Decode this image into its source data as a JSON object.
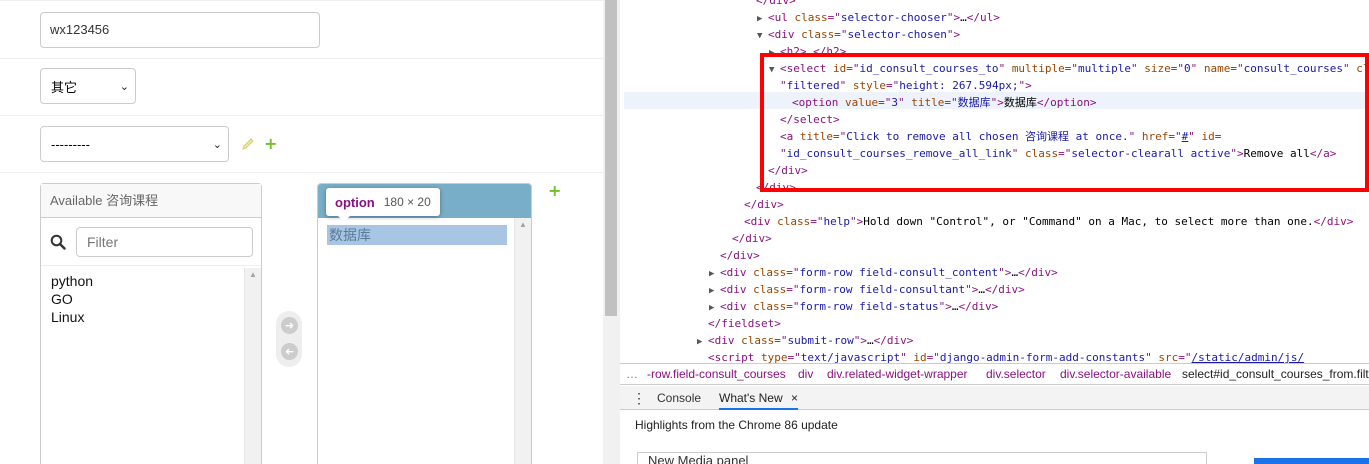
{
  "form": {
    "wechat_value": "wx123456",
    "source_select": "其它",
    "related_select": "---------",
    "available": {
      "title": "Available 咨询课程",
      "filter_placeholder": "Filter",
      "items": [
        "python",
        "GO",
        "Linux"
      ]
    },
    "chosen": {
      "items": [
        "数据库"
      ]
    },
    "colors": {
      "chosen_header": "#79aec8",
      "add_green": "#70bf2b"
    }
  },
  "inspect_tooltip": {
    "tag": "option",
    "dimensions": "180 × 20"
  },
  "devtools": {
    "lines": [
      {
        "indent": 0,
        "tri": "",
        "parts": [
          [
            "tg",
            "</div>"
          ]
        ]
      },
      {
        "indent": 1,
        "tri": "▶",
        "parts": [
          [
            "tg",
            "<ul "
          ],
          [
            "at",
            "class"
          ],
          [
            "tg",
            "=\""
          ],
          [
            "av",
            "selector-chooser"
          ],
          [
            "tg",
            "\">"
          ],
          [
            "tx",
            "…"
          ],
          [
            "tg",
            "</ul>"
          ]
        ]
      },
      {
        "indent": 1,
        "tri": "▼",
        "parts": [
          [
            "tg",
            "<div "
          ],
          [
            "at",
            "class"
          ],
          [
            "tg",
            "=\""
          ],
          [
            "av",
            "selector-chosen"
          ],
          [
            "tg",
            "\">"
          ]
        ]
      },
      {
        "indent": 2,
        "tri": "▶",
        "parts": [
          [
            "tg",
            "<h2>"
          ],
          [
            "tx",
            "…"
          ],
          [
            "tg",
            "</h2>"
          ]
        ]
      },
      {
        "indent": 2,
        "tri": "▼",
        "parts": [
          [
            "tg",
            "<select "
          ],
          [
            "at",
            "id"
          ],
          [
            "tg",
            "=\""
          ],
          [
            "av",
            "id_consult_courses_to"
          ],
          [
            "tg",
            "\" "
          ],
          [
            "at",
            "multiple"
          ],
          [
            "tg",
            "=\""
          ],
          [
            "av",
            "multiple"
          ],
          [
            "tg",
            "\" "
          ],
          [
            "at",
            "size"
          ],
          [
            "tg",
            "=\""
          ],
          [
            "av",
            "0"
          ],
          [
            "tg",
            "\" "
          ],
          [
            "at",
            "name"
          ],
          [
            "tg",
            "=\""
          ],
          [
            "av",
            "consult_courses"
          ],
          [
            "tg",
            "\" "
          ],
          [
            "at",
            "class"
          ],
          [
            "tg",
            "="
          ]
        ]
      },
      {
        "indent": 2,
        "tri": "",
        "parts": [
          [
            "tg",
            "\""
          ],
          [
            "av",
            "filtered"
          ],
          [
            "tg",
            "\" "
          ],
          [
            "at",
            "style"
          ],
          [
            "tg",
            "=\""
          ],
          [
            "av",
            "height: 267.594px;"
          ],
          [
            "tg",
            "\">"
          ]
        ]
      },
      {
        "indent": 3,
        "tri": "",
        "parts": [
          [
            "tg",
            "<option "
          ],
          [
            "at",
            "value"
          ],
          [
            "tg",
            "=\""
          ],
          [
            "av",
            "3"
          ],
          [
            "tg",
            "\" "
          ],
          [
            "at",
            "title"
          ],
          [
            "tg",
            "=\""
          ],
          [
            "av",
            "数据库"
          ],
          [
            "tg",
            "\">"
          ],
          [
            "tx",
            "数据库"
          ],
          [
            "tg",
            "</option>"
          ]
        ]
      },
      {
        "indent": 2,
        "tri": "",
        "parts": [
          [
            "tg",
            "</select>"
          ]
        ]
      },
      {
        "indent": 2,
        "tri": "",
        "parts": [
          [
            "tg",
            "<a "
          ],
          [
            "at",
            "title"
          ],
          [
            "tg",
            "=\""
          ],
          [
            "av",
            "Click to remove all chosen 咨询课程 at once."
          ],
          [
            "tg",
            "\" "
          ],
          [
            "at",
            "href"
          ],
          [
            "tg",
            "=\""
          ],
          [
            "lk",
            "#"
          ],
          [
            "tg",
            "\" "
          ],
          [
            "at",
            "id"
          ],
          [
            "tg",
            "="
          ]
        ]
      },
      {
        "indent": 2,
        "tri": "",
        "parts": [
          [
            "tg",
            "\""
          ],
          [
            "av",
            "id_consult_courses_remove_all_link"
          ],
          [
            "tg",
            "\" "
          ],
          [
            "at",
            "class"
          ],
          [
            "tg",
            "=\""
          ],
          [
            "av",
            "selector-clearall active"
          ],
          [
            "tg",
            "\">"
          ],
          [
            "tx",
            "Remove all"
          ],
          [
            "tg",
            "</a>"
          ]
        ]
      },
      {
        "indent": 1,
        "tri": "",
        "parts": [
          [
            "tg",
            "</div>"
          ]
        ]
      },
      {
        "indent": 0,
        "tri": "",
        "parts": [
          [
            "tg",
            "</div>"
          ]
        ]
      },
      {
        "indent": -1,
        "tri": "",
        "parts": [
          [
            "tg",
            "</div>"
          ]
        ]
      },
      {
        "indent": -1,
        "tri": "",
        "parts": [
          [
            "tg",
            "<div "
          ],
          [
            "at",
            "class"
          ],
          [
            "tg",
            "=\""
          ],
          [
            "av",
            "help"
          ],
          [
            "tg",
            "\">"
          ],
          [
            "tx",
            "Hold down \"Control\", or \"Command\" on a Mac, to select more than one."
          ],
          [
            "tg",
            "</div>"
          ]
        ]
      },
      {
        "indent": -2,
        "tri": "",
        "parts": [
          [
            "tg",
            "</div>"
          ]
        ]
      },
      {
        "indent": -3,
        "tri": "",
        "parts": [
          [
            "tg",
            "</div>"
          ]
        ]
      },
      {
        "indent": -3,
        "tri": "▶",
        "parts": [
          [
            "tg",
            "<div "
          ],
          [
            "at",
            "class"
          ],
          [
            "tg",
            "=\""
          ],
          [
            "av",
            "form-row field-consult_content"
          ],
          [
            "tg",
            "\">"
          ],
          [
            "tx",
            "…"
          ],
          [
            "tg",
            "</div>"
          ]
        ]
      },
      {
        "indent": -3,
        "tri": "▶",
        "parts": [
          [
            "tg",
            "<div "
          ],
          [
            "at",
            "class"
          ],
          [
            "tg",
            "=\""
          ],
          [
            "av",
            "form-row field-consultant"
          ],
          [
            "tg",
            "\">"
          ],
          [
            "tx",
            "…"
          ],
          [
            "tg",
            "</div>"
          ]
        ]
      },
      {
        "indent": -3,
        "tri": "▶",
        "parts": [
          [
            "tg",
            "<div "
          ],
          [
            "at",
            "class"
          ],
          [
            "tg",
            "=\""
          ],
          [
            "av",
            "form-row field-status"
          ],
          [
            "tg",
            "\">"
          ],
          [
            "tx",
            "…"
          ],
          [
            "tg",
            "</div>"
          ]
        ]
      },
      {
        "indent": -4,
        "tri": "",
        "parts": [
          [
            "tg",
            "</fieldset>"
          ]
        ]
      },
      {
        "indent": -4,
        "tri": "▶",
        "parts": [
          [
            "tg",
            "<div "
          ],
          [
            "at",
            "class"
          ],
          [
            "tg",
            "=\""
          ],
          [
            "av",
            "submit-row"
          ],
          [
            "tg",
            "\">"
          ],
          [
            "tx",
            "…"
          ],
          [
            "tg",
            "</div>"
          ]
        ]
      },
      {
        "indent": -4,
        "tri": "",
        "parts": [
          [
            "tg",
            "<script "
          ],
          [
            "at",
            "type"
          ],
          [
            "tg",
            "=\""
          ],
          [
            "av",
            "text/javascript"
          ],
          [
            "tg",
            "\" "
          ],
          [
            "at",
            "id"
          ],
          [
            "tg",
            "=\""
          ],
          [
            "av",
            "django-admin-form-add-constants"
          ],
          [
            "tg",
            "\" "
          ],
          [
            "at",
            "src"
          ],
          [
            "tg",
            "=\""
          ],
          [
            "lk",
            "/static/admin/js/"
          ]
        ]
      }
    ],
    "breadcrumbs": [
      "…",
      "-row.field-consult_courses",
      "div",
      "div.related-widget-wrapper",
      "div.selector",
      "div.selector-available",
      "select#id_consult_courses_from.filter"
    ],
    "drawer_tabs": {
      "console": "Console",
      "whats_new": "What's New",
      "close": "×"
    },
    "highlights": "Highlights from the Chrome 86 update",
    "bottom_fragment": "New Media panel"
  }
}
